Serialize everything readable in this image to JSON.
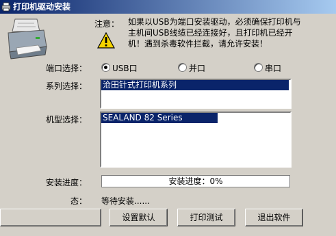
{
  "window": {
    "title": "打印机驱动安装"
  },
  "notice": {
    "label": "注意：",
    "text": "如果以USB为端口安装驱动，必须确保打印机与主机间USB线缆已经连接好，且打印机已经开机！遇到杀毒软件拦截，请允许安装！"
  },
  "port": {
    "label": "端口选择：",
    "options": [
      {
        "label": "USB口",
        "selected": true
      },
      {
        "label": "并口",
        "selected": false
      },
      {
        "label": "串口",
        "selected": false
      }
    ]
  },
  "series": {
    "label": "系列选择：",
    "items": [
      "沧田针式打印机系列"
    ]
  },
  "model": {
    "label": "机型选择：",
    "items": [
      "SEALAND 82 Series"
    ]
  },
  "progress": {
    "label": "安装进度：",
    "text": "安装进度：0%",
    "value": 0
  },
  "status": {
    "label": "态：",
    "value": "等待安装......"
  },
  "buttons": {
    "first": "",
    "defaults": "设置默认",
    "test_print": "打印测试",
    "exit": "退出软件"
  },
  "icons": {
    "title": "printer-icon",
    "printer": "printer-icon",
    "warning": "warning-icon"
  },
  "colors": {
    "selection": "#0a246a",
    "face": "#d4d0c8"
  }
}
